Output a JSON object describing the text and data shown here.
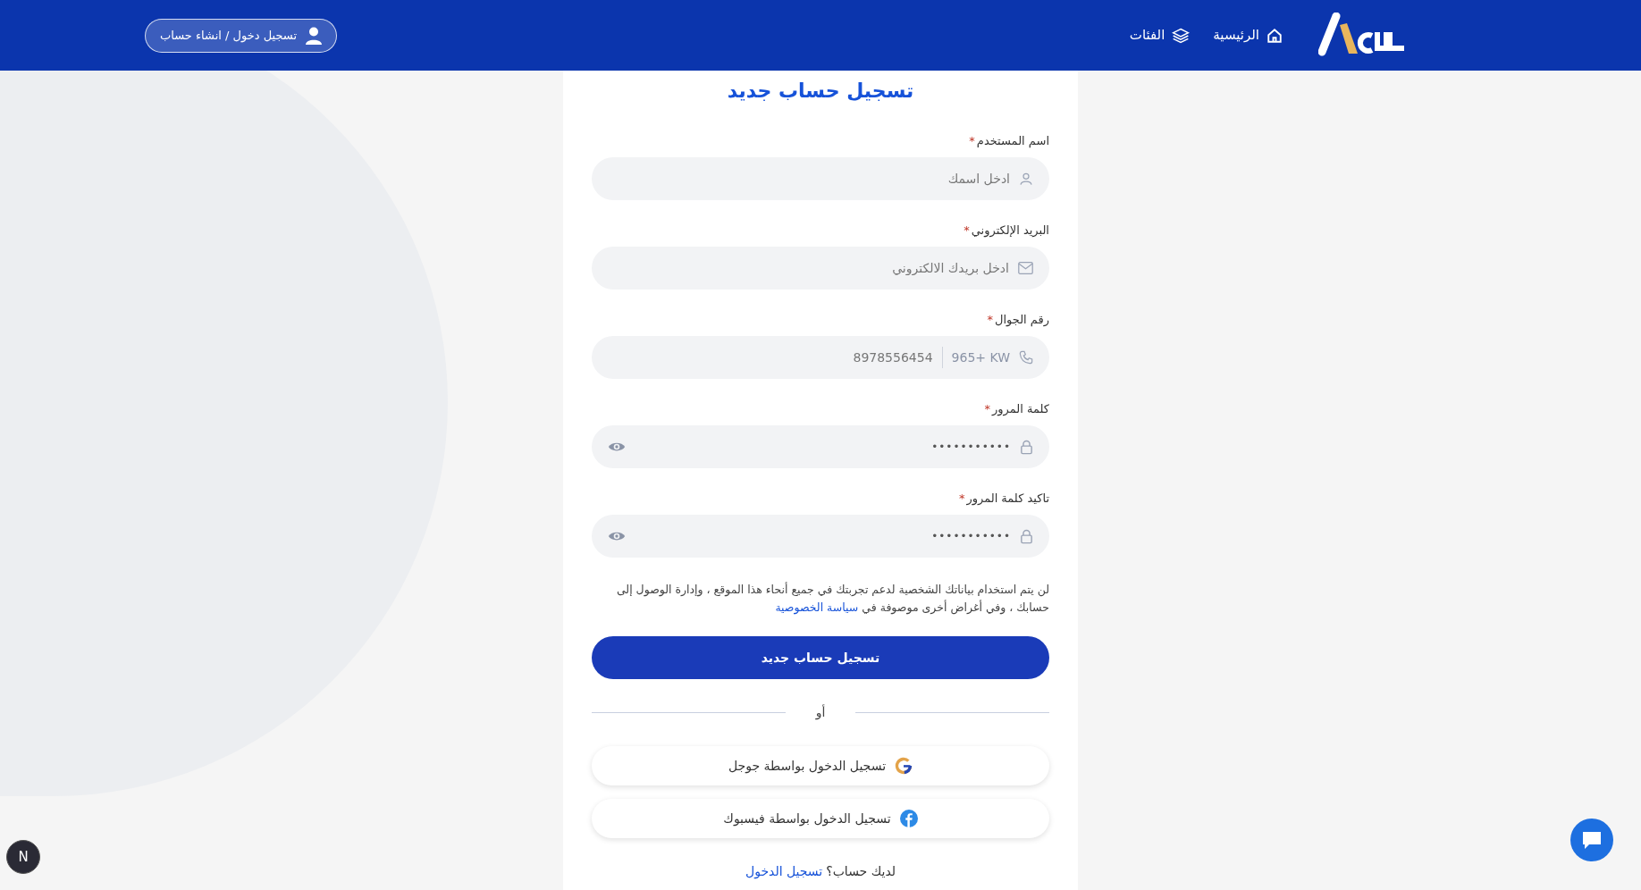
{
  "header": {
    "nav": [
      {
        "label": "الرئيسية"
      },
      {
        "label": "الفئات"
      }
    ],
    "auth_button": "تسجيل دخول / انشاء حساب"
  },
  "form": {
    "title": "تسجيل حساب جديد",
    "fields": [
      {
        "kind": "name",
        "label": "اسم المستخدم",
        "required_mark": "*",
        "placeholder": "ادخل اسمك"
      },
      {
        "kind": "email",
        "label": "البريد الإلكتروني",
        "required_mark": "*",
        "placeholder": "ادخل بريدك الالكتروني"
      },
      {
        "kind": "phone",
        "label": "رقم الجوال",
        "required_mark": "*",
        "country_code": "KW",
        "dial_code": "965+",
        "placeholder": "8978556454"
      },
      {
        "kind": "password",
        "label": "كلمة المرور",
        "required_mark": "*",
        "value": "•••••••••••"
      },
      {
        "kind": "password",
        "label": "تاكيد كلمة المرور",
        "required_mark": "*",
        "value": "•••••••••••"
      }
    ],
    "privacy_note": "لن يتم استخدام بياناتك الشخصية لدعم تجربتك في جميع أنحاء هذا الموقع ، وإدارة الوصول إلى حسابك ، وفي أغراض أخرى موصوفة في",
    "privacy_link": "سياسة الخصوصية",
    "submit": "تسجيل حساب جديد",
    "divider": "أو",
    "social": [
      {
        "kind": "google",
        "label": "تسجيل الدخول بواسطة جوجل"
      },
      {
        "kind": "facebook",
        "label": "تسجيل الدخول بواسطة فيسبوك"
      }
    ],
    "footer_text": "لديك حساب؟",
    "footer_link": "تسجيل الدخول"
  },
  "dev_badge": "N"
}
